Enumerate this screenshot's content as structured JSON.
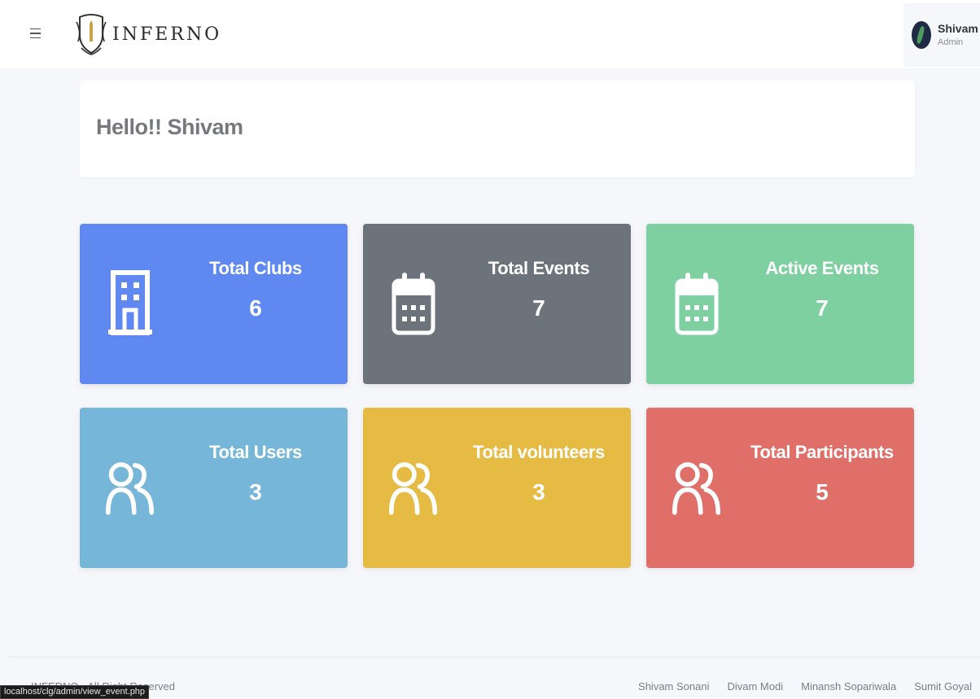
{
  "header": {
    "menu_icon": "hamburger-icon",
    "logo_text": "INFERNO",
    "user": {
      "name": "Shivam",
      "role": "Admin"
    }
  },
  "greeting": "Hello!! Shivam",
  "stats": [
    {
      "label": "Total Clubs",
      "value": "6",
      "icon": "building-icon",
      "color": "#5f89f0"
    },
    {
      "label": "Total Events",
      "value": "7",
      "icon": "calendar-icon",
      "color": "#6c737a"
    },
    {
      "label": "Active Events",
      "value": "7",
      "icon": "calendar-icon",
      "color": "#7ed0a0"
    },
    {
      "label": "Total Users",
      "value": "3",
      "icon": "users-icon",
      "color": "#76b6d8"
    },
    {
      "label": "Total volunteers",
      "value": "3",
      "icon": "users-icon",
      "color": "#e6bb43"
    },
    {
      "label": "Total Participants",
      "value": "5",
      "icon": "users-icon",
      "color": "#e06f6a"
    }
  ],
  "footer": {
    "copyright": "INFERNO - All Right Reserved",
    "links": [
      "Shivam Sonani",
      "Divam Modi",
      "Minansh Sopariwala",
      "Sumit Goyal"
    ]
  },
  "status_url": "localhost/clg/admin/view_event.php"
}
